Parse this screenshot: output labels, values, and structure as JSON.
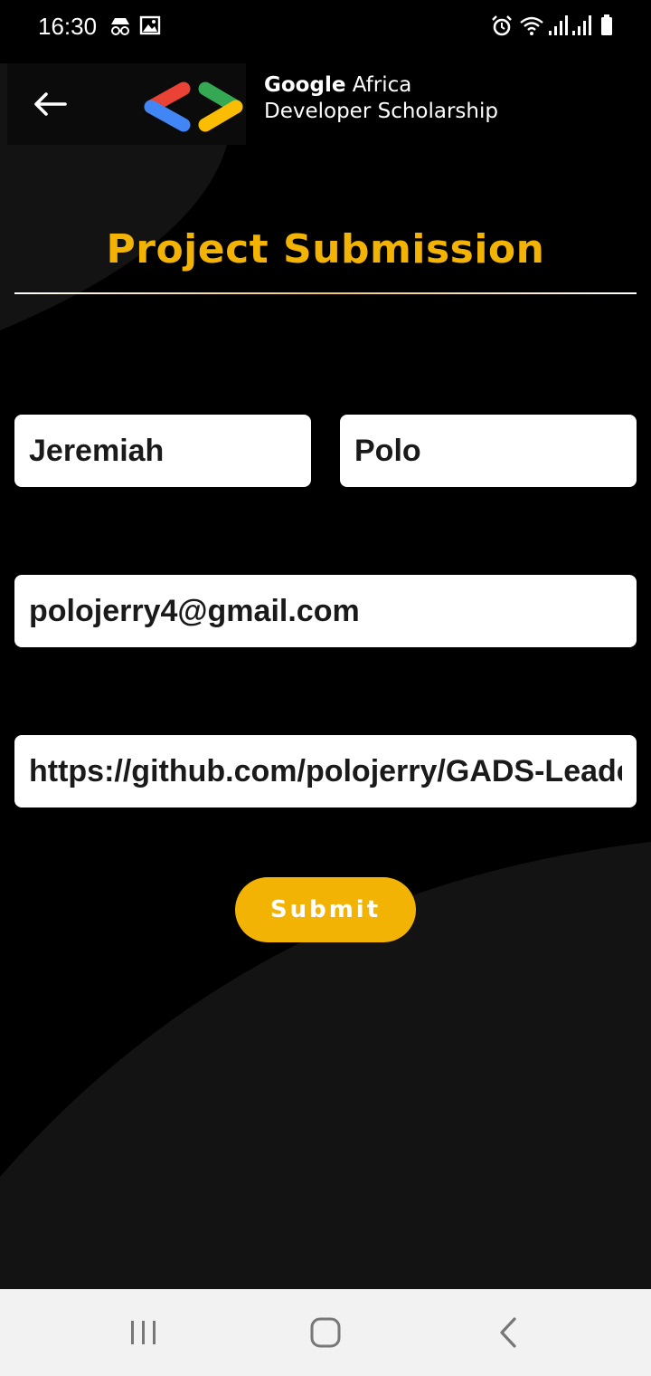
{
  "status_bar": {
    "time": "16:30",
    "left_icons": [
      "incognito-icon",
      "image-icon"
    ],
    "right_icons": [
      "alarm-icon",
      "wifi-icon",
      "signal-icon",
      "signal-icon",
      "battery-icon"
    ]
  },
  "header": {
    "back_icon": "arrow-left-icon",
    "brand_line1_bold": "Google",
    "brand_line1_rest": " Africa",
    "brand_line2": "Developer Scholarship"
  },
  "title": "Project Submission",
  "form": {
    "first_name": "Jeremiah",
    "last_name": "Polo",
    "email": "polojerry4@gmail.com",
    "project_link": "https://github.com/polojerry/GADS-Leaderboard"
  },
  "submit_label": "Submit",
  "nav": {
    "recents_icon": "recents-icon",
    "home_icon": "home-icon",
    "back_icon": "back-icon"
  },
  "colors": {
    "accent": "#f2b304",
    "background": "#000000",
    "surface": "#131313"
  }
}
